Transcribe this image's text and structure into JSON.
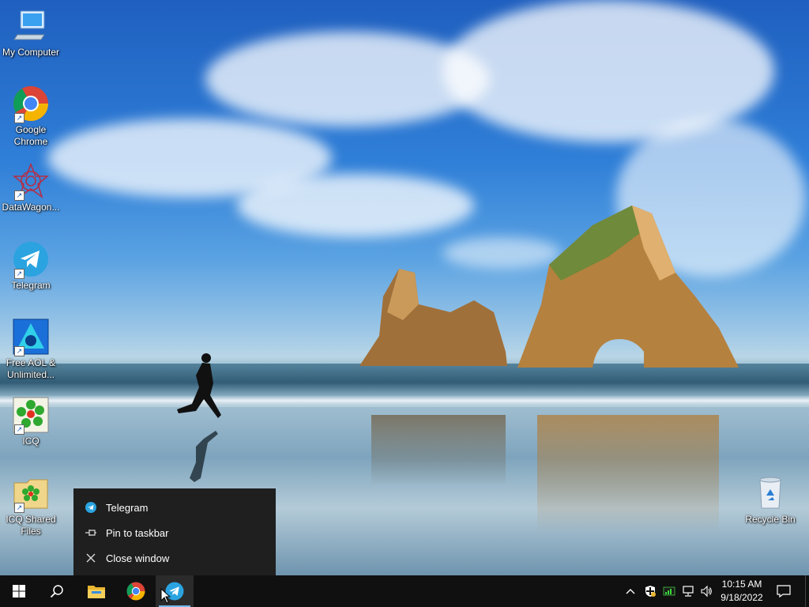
{
  "desktop": {
    "icons": [
      {
        "label": "My Computer",
        "icon": "computer-icon"
      },
      {
        "label": "Google Chrome",
        "icon": "chrome-icon"
      },
      {
        "label": "DataWagon...",
        "icon": "datawagon-icon"
      },
      {
        "label": "Telegram",
        "icon": "telegram-icon"
      },
      {
        "label": "Free AOL & Unlimited...",
        "icon": "aol-icon"
      },
      {
        "label": "ICQ",
        "icon": "icq-icon"
      },
      {
        "label": "ICQ Shared Files",
        "icon": "icq-folder-icon"
      },
      {
        "label": "Recycle Bin",
        "icon": "recycle-bin-icon"
      }
    ]
  },
  "jump_menu": {
    "items": [
      {
        "label": "Telegram",
        "icon": "telegram-icon"
      },
      {
        "label": "Pin to taskbar",
        "icon": "pin-icon"
      },
      {
        "label": "Close window",
        "icon": "close-icon"
      }
    ]
  },
  "taskbar": {
    "buttons": [
      {
        "name": "start",
        "icon": "windows-logo-icon"
      },
      {
        "name": "search",
        "icon": "search-icon"
      },
      {
        "name": "file-explorer",
        "icon": "folder-icon"
      },
      {
        "name": "chrome",
        "icon": "chrome-icon"
      },
      {
        "name": "telegram",
        "icon": "telegram-icon",
        "active": true
      }
    ],
    "tray_icons": [
      "chevron-up-icon",
      "security-icon",
      "pro-badge-icon",
      "network-icon",
      "volume-icon"
    ],
    "clock": {
      "time": "10:15 AM",
      "date": "9/18/2022"
    },
    "notifications_icon": "action-center-icon"
  },
  "colors": {
    "taskbar": "#101010",
    "menu": "#1f1f1f",
    "accent": "#76b9ed",
    "telegram": "#2aa3e0"
  }
}
